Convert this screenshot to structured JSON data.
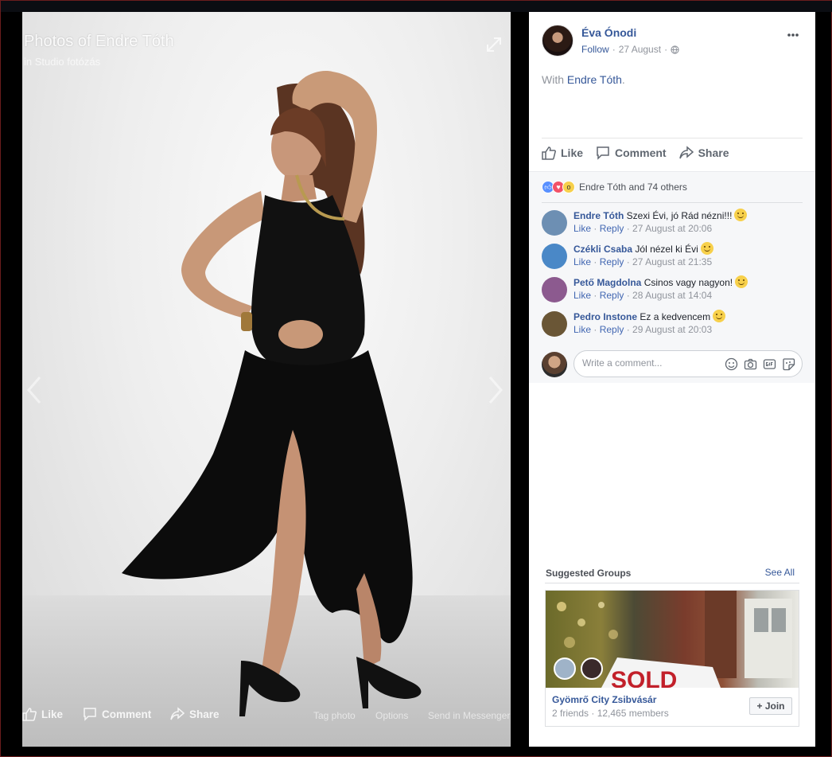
{
  "photo": {
    "title": "Photos of Endre Tóth",
    "album": "in Studio fotózás",
    "actions": {
      "like": "Like",
      "comment": "Comment",
      "share": "Share"
    },
    "secondary": {
      "tag": "Tag photo",
      "options": "Options",
      "send": "Send in Messenger"
    }
  },
  "post": {
    "author": "Éva Ónodi",
    "follow": "Follow",
    "date": "27 August",
    "with_prefix": "With",
    "with_name": "Endre Tóth",
    "with_suffix": ".",
    "actions": {
      "like": "Like",
      "comment": "Comment",
      "share": "Share"
    }
  },
  "reactions": {
    "icons": [
      "like-icon",
      "love-icon",
      "wow-icon"
    ],
    "text": "Endre Tóth and 74 others"
  },
  "comments": [
    {
      "name": "Endre Tóth",
      "text": "Szexi Évi, jó Rád nézni!!!",
      "emoji": true,
      "like": "Like",
      "reply": "Reply",
      "time": "27 August at 20:06",
      "avatar_color": "#6d8fb3"
    },
    {
      "name": "Czékli Csaba",
      "text": "Jól nézel ki Évi",
      "emoji": true,
      "like": "Like",
      "reply": "Reply",
      "time": "27 August at 21:35",
      "avatar_color": "#4a88c7"
    },
    {
      "name": "Pető Magdolna",
      "text": "Csinos vagy nagyon!",
      "emoji": true,
      "like": "Like",
      "reply": "Reply",
      "time": "28 August at 14:04",
      "avatar_color": "#8c5a8f"
    },
    {
      "name": "Pedro Instone",
      "text": "Ez a kedvencem",
      "emoji": true,
      "like": "Like",
      "reply": "Reply",
      "time": "29 August at 20:03",
      "avatar_color": "#6a5636"
    }
  ],
  "write_comment": {
    "placeholder": "Write a comment..."
  },
  "suggested": {
    "title": "Suggested Groups",
    "see_all": "See All",
    "group_name": "Gyömrő City Zsibvásár",
    "group_sub": "2 friends · 12,465 members",
    "join": "+ Join",
    "sign_text": "SOLD"
  },
  "colors": {
    "link": "#365899",
    "muted": "#90949c",
    "accent": "#4267b2"
  }
}
